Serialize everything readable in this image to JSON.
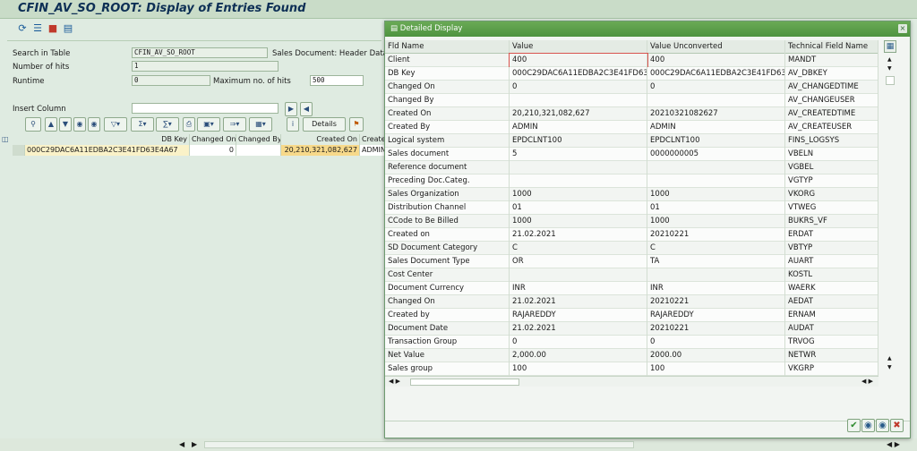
{
  "window": {
    "title": "CFIN_AV_SO_ROOT: Display of Entries Found"
  },
  "toolbar_icons": [
    "refresh-icon",
    "filter-icon",
    "settings-icon",
    "list-icon"
  ],
  "form": {
    "search_label": "Search in Table",
    "search_value": "CFIN_AV_SO_ROOT",
    "search_desc": "Sales Document: Header Data",
    "hits_label": "Number of hits",
    "hits_value": "1",
    "runtime_label": "Runtime",
    "runtime_value": "0",
    "max_hits_label": "Maximum no. of hits",
    "max_hits_value": "500",
    "insert_label": "Insert Column",
    "insert_value": ""
  },
  "alv": {
    "details_label": "Details"
  },
  "grid": {
    "headers": [
      "DB Key",
      "Changed On",
      "Changed By",
      "Created On",
      "Created B"
    ],
    "row": [
      "000C29DAC6A11EDBA2C3E41FD63E4A67",
      "0",
      "",
      "20,210,321,082,627",
      "ADMIN"
    ]
  },
  "popup": {
    "title": "Detailed Display",
    "headers": [
      "Fld Name",
      "Value",
      "Value Unconverted",
      "Technical Field Name"
    ],
    "rows": [
      [
        "Client",
        "400",
        "400",
        "MANDT"
      ],
      [
        "DB Key",
        "000C29DAC6A11EDBA2C3E41FD63E4...",
        "000C29DAC6A11EDBA2C3E41FD63E4...",
        "AV_DBKEY"
      ],
      [
        "Changed On",
        "0",
        "0",
        "AV_CHANGEDTIME"
      ],
      [
        "Changed By",
        "",
        "",
        "AV_CHANGEUSER"
      ],
      [
        "Created On",
        "20,210,321,082,627",
        "20210321082627",
        "AV_CREATEDTIME"
      ],
      [
        "Created By",
        "ADMIN",
        "ADMIN",
        "AV_CREATEUSER"
      ],
      [
        "Logical system",
        "EPDCLNT100",
        "EPDCLNT100",
        "FINS_LOGSYS"
      ],
      [
        "Sales document",
        "5",
        "0000000005",
        "VBELN"
      ],
      [
        "Reference document",
        "",
        "",
        "VGBEL"
      ],
      [
        "Preceding Doc.Categ.",
        "",
        "",
        "VGTYP"
      ],
      [
        "Sales Organization",
        "1000",
        "1000",
        "VKORG"
      ],
      [
        "Distribution Channel",
        "01",
        "01",
        "VTWEG"
      ],
      [
        "CCode to Be Billed",
        "1000",
        "1000",
        "BUKRS_VF"
      ],
      [
        "Created on",
        "21.02.2021",
        "20210221",
        "ERDAT"
      ],
      [
        "SD Document Category",
        "C",
        "C",
        "VBTYP"
      ],
      [
        "Sales Document Type",
        "OR",
        "TA",
        "AUART"
      ],
      [
        "Cost Center",
        "",
        "",
        "KOSTL"
      ],
      [
        "Document Currency",
        "INR",
        "INR",
        "WAERK"
      ],
      [
        "Changed On",
        "21.02.2021",
        "20210221",
        "AEDAT"
      ],
      [
        "Created by",
        "RAJAREDDY",
        "RAJAREDDY",
        "ERNAM"
      ],
      [
        "Document Date",
        "21.02.2021",
        "20210221",
        "AUDAT"
      ],
      [
        "Transaction Group",
        "0",
        "0",
        "TRVOG"
      ],
      [
        "Net Value",
        "2,000.00",
        "2000.00",
        "NETWR"
      ],
      [
        "Sales group",
        "100",
        "100",
        "VKGRP"
      ]
    ]
  },
  "colors": {
    "accent": "#4e9340",
    "title_text": "#0d2f55",
    "highlight": "#f7d98a"
  }
}
